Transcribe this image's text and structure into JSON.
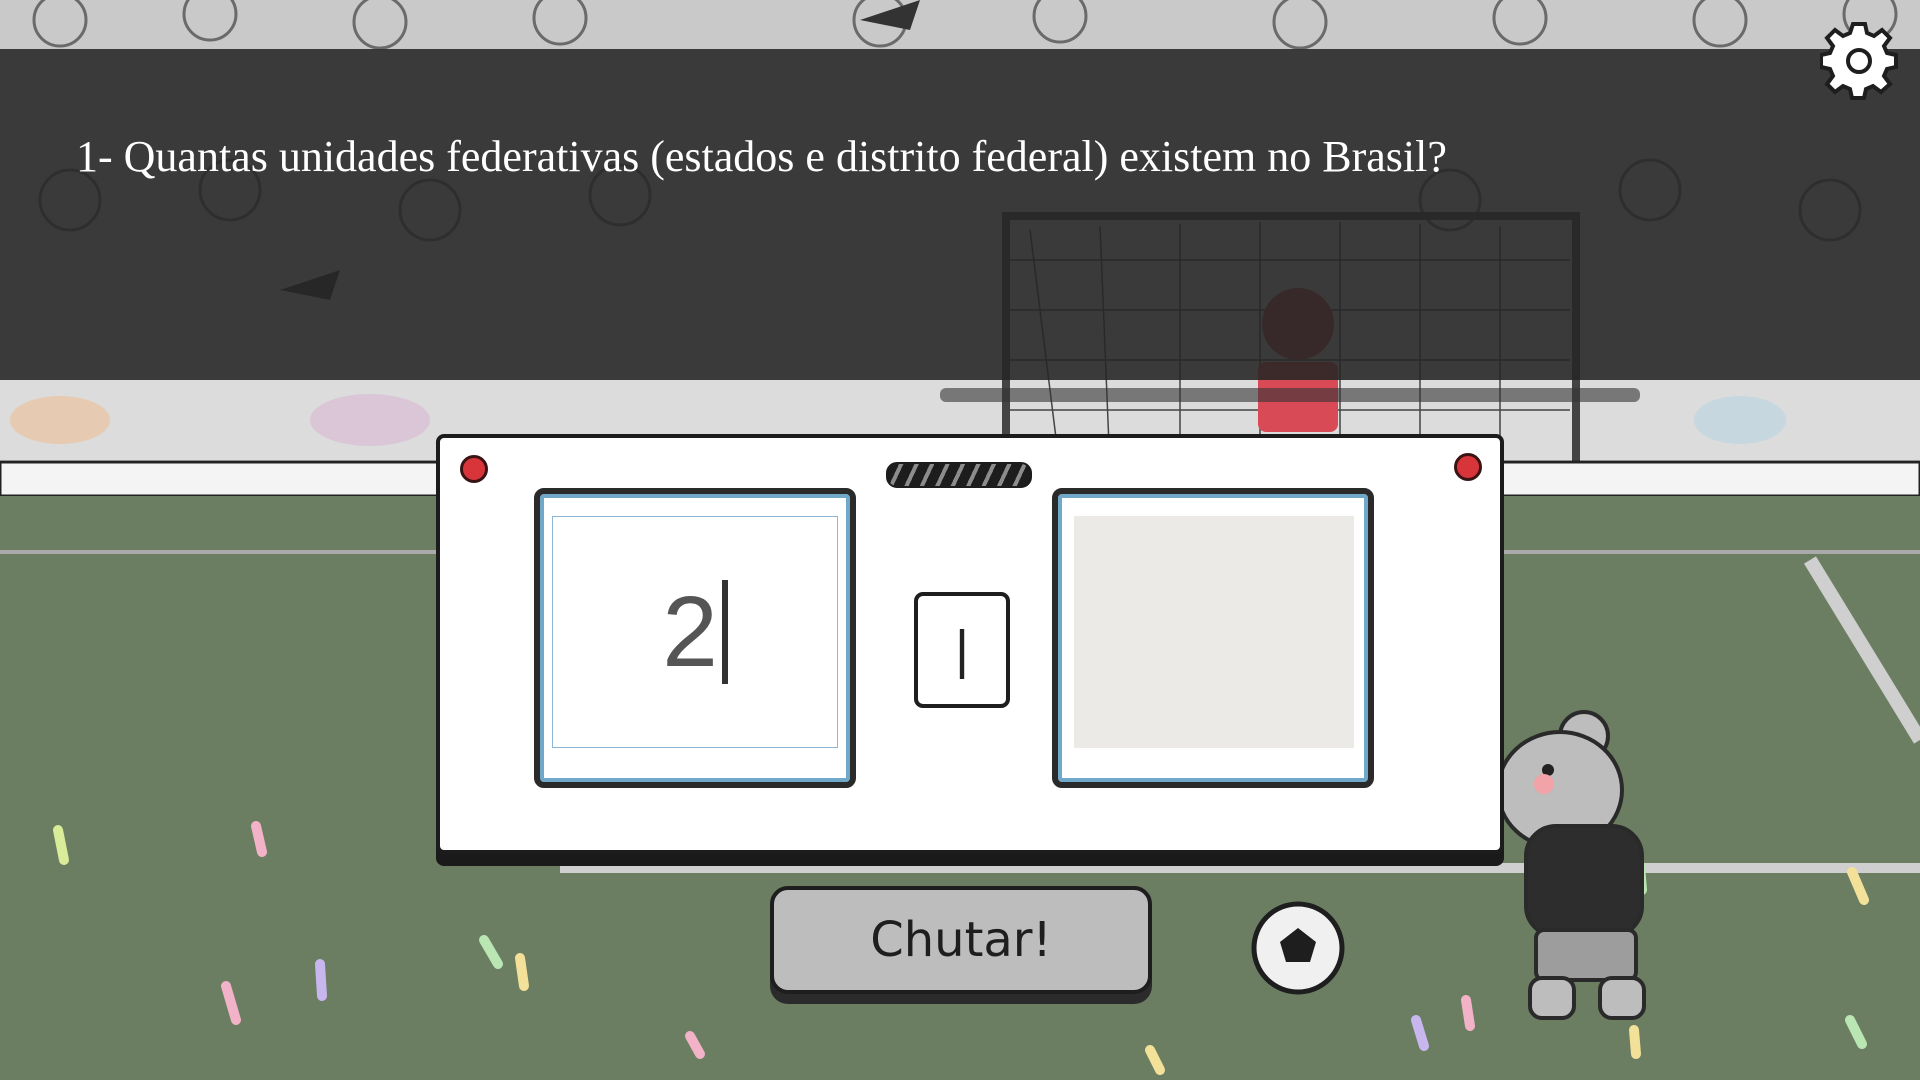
{
  "question": {
    "text": "1- Quantas unidades federativas (estados e distrito federal) existem no Brasil?"
  },
  "settings": {
    "icon": "gear-icon"
  },
  "scoreboard": {
    "answer_value": "2",
    "separator": "|",
    "right_value": ""
  },
  "kick_button": {
    "label": "Chutar!"
  },
  "colors": {
    "overlay": "#262626",
    "field": "#6f8266",
    "led": "#d8353a",
    "frame_accent": "#6fa8c9"
  }
}
